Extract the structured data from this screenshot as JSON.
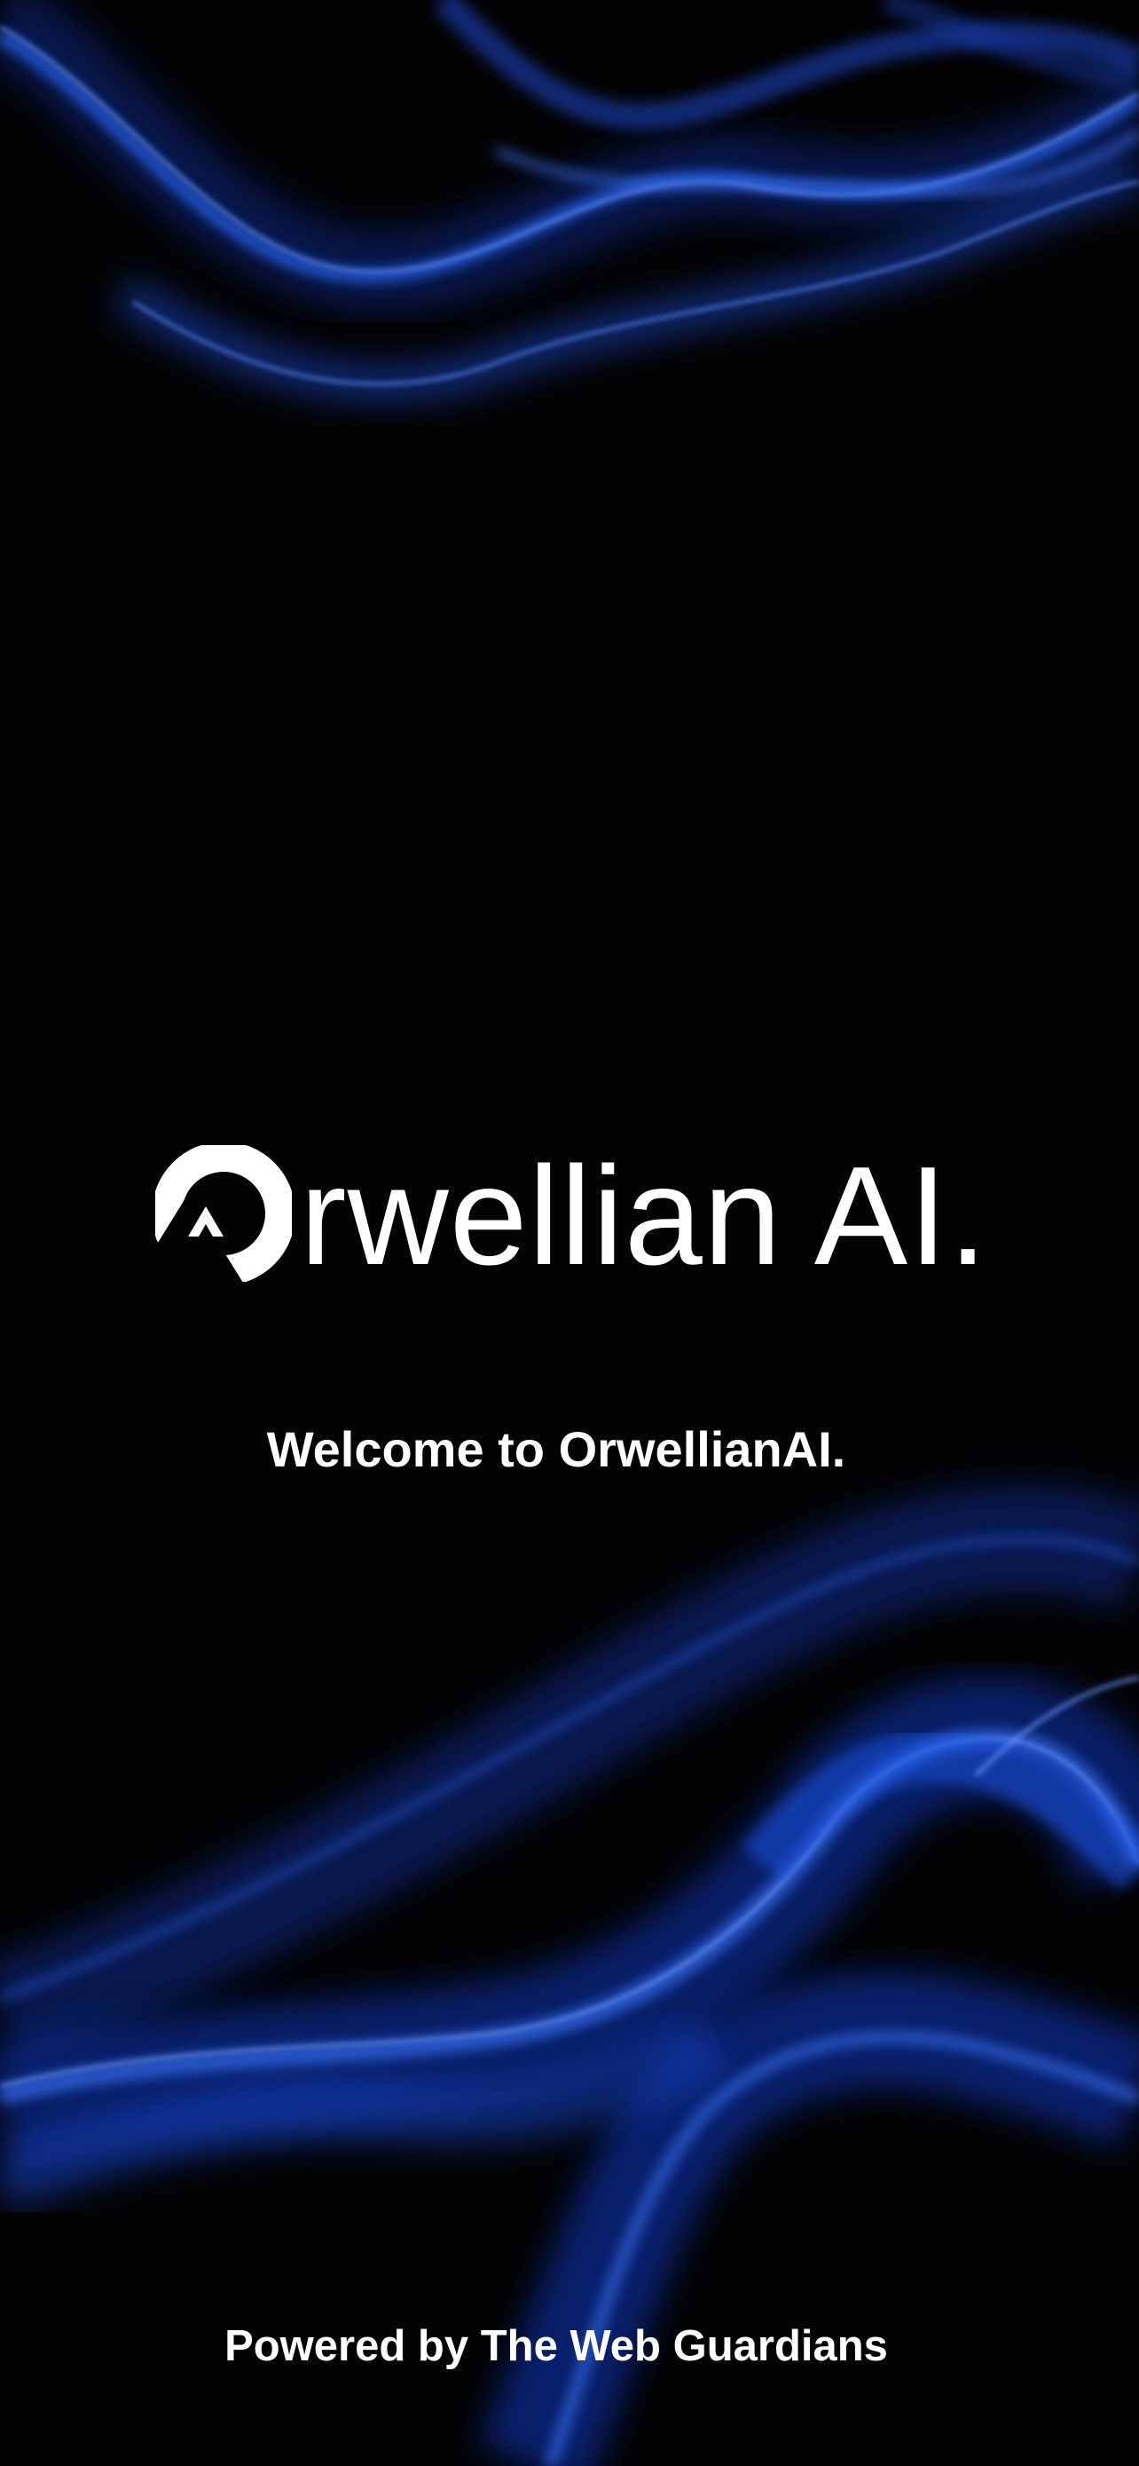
{
  "splash": {
    "logo_text": "rwellian AI.",
    "logo_mark_icon": "circle-a-logo-icon",
    "welcome_text": "Welcome to OrwellianAI.",
    "footer_text": "Powered by The Web Guardians"
  },
  "colors": {
    "background": "#030305",
    "smoke_blue": "#1f5fff",
    "text": "#ffffff"
  }
}
